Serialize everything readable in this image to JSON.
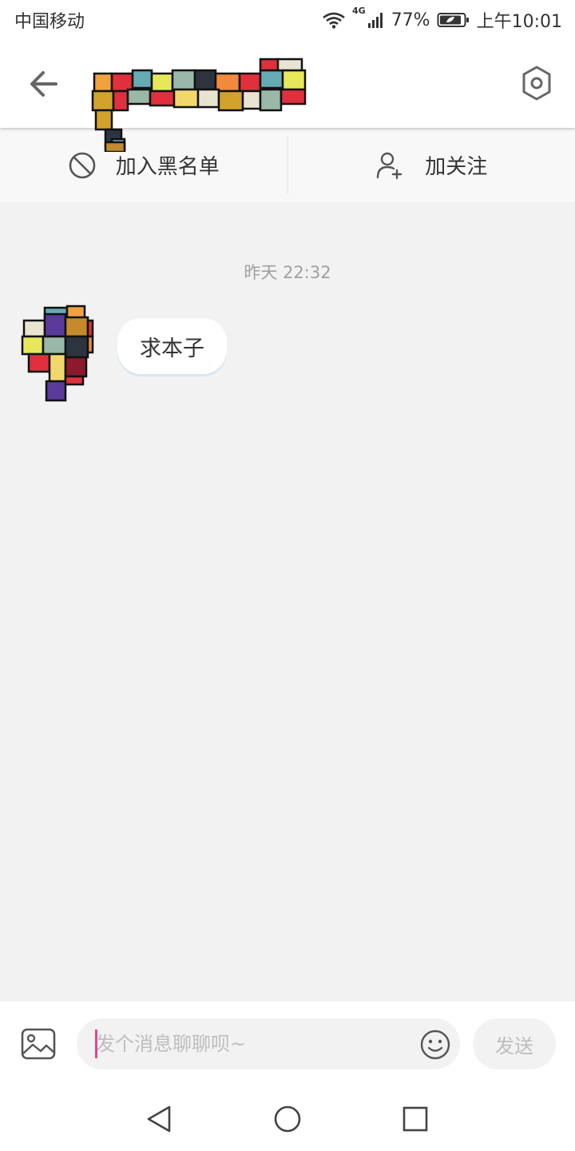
{
  "status_bar": {
    "carrier": "中国移动",
    "network": "4G",
    "battery": "77%",
    "time": "上午10:01"
  },
  "header": {
    "back_icon": "arrow-left-icon",
    "settings_icon": "hexagon-gear-icon",
    "title": ""
  },
  "actions": {
    "blacklist_label": "加入黑名单",
    "follow_label": "加关注"
  },
  "chat": {
    "timestamp": "昨天 22:32",
    "messages": [
      {
        "sender": "other",
        "text": "求本子"
      }
    ]
  },
  "input_bar": {
    "placeholder": "发个消息聊聊呗~",
    "send_label": "发送"
  },
  "colors": {
    "accent_cursor": "#e6468a",
    "background": "#f2f2f2"
  }
}
